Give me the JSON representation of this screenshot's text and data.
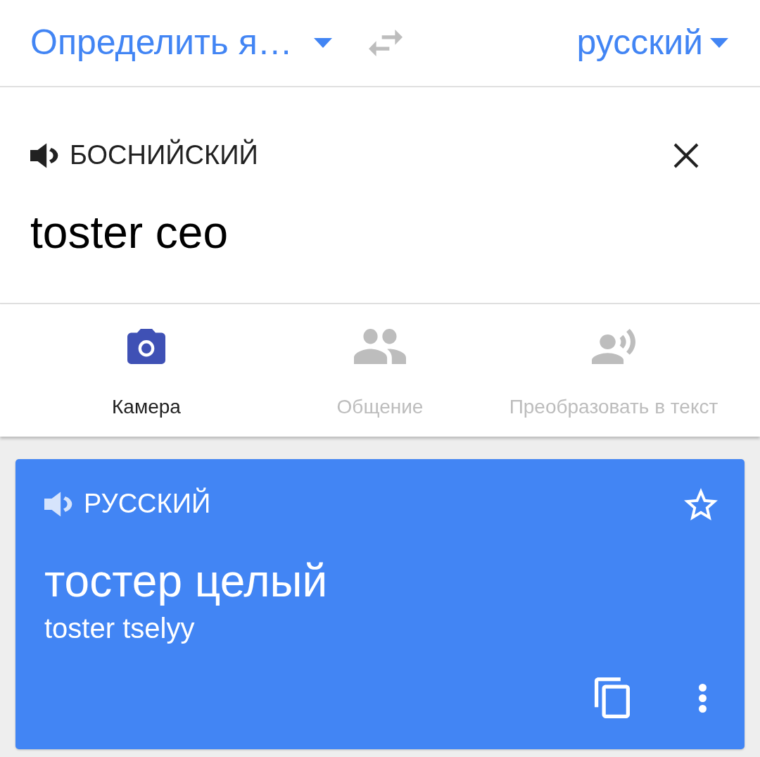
{
  "language_bar": {
    "source_language": "Определить я…",
    "target_language": "русский"
  },
  "input": {
    "language_label": "БОСНИЙСКИЙ",
    "text": "toster ceo"
  },
  "tools": [
    {
      "kind": "camera",
      "label": "Камера",
      "disabled": false
    },
    {
      "kind": "conversation",
      "label": "Общение",
      "disabled": true
    },
    {
      "kind": "transcribe",
      "label": "Преобразовать в текст",
      "disabled": true
    }
  ],
  "result": {
    "language_label": "РУССКИЙ",
    "text": "тостер целый",
    "transliteration": "toster tselyy",
    "starred": false
  }
}
